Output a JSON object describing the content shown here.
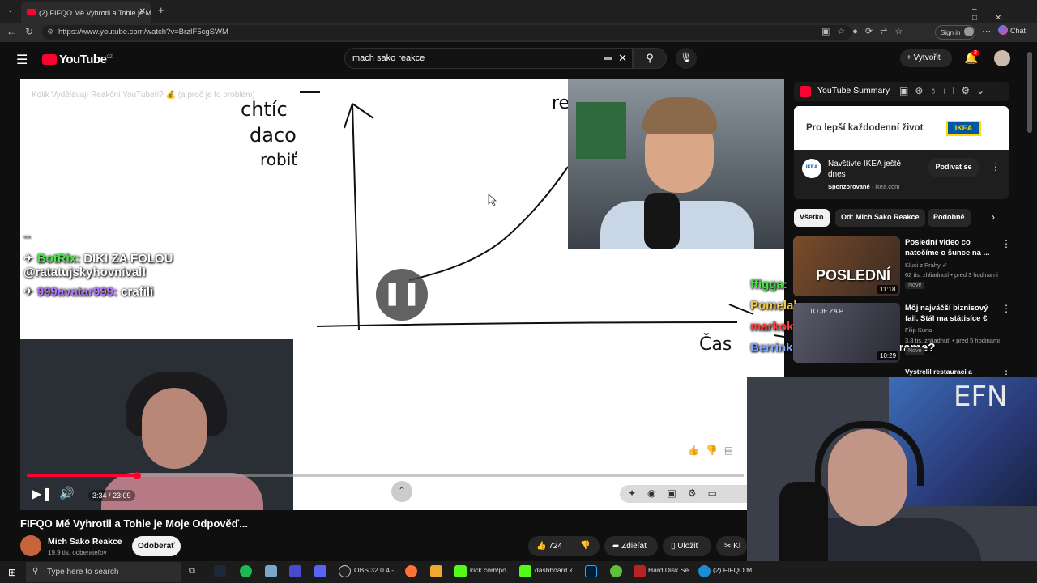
{
  "browser": {
    "tab_title": "(2) FIFQO Mě Vyhrotil a Tohle je M",
    "url": "https://www.youtube.com/watch?v=BrzIF5cgSWM",
    "sign_in": "Sign in",
    "chat_label": "Chat"
  },
  "youtube": {
    "logo": "YouTube",
    "region": "CZ",
    "search_value": "mach sako reakce",
    "create_label": "Vytvořit",
    "notif_count": "2"
  },
  "video": {
    "overlay_title": "Kolik Vydělávají Reakční YouTubeři? 💰 (a proč je to problém)",
    "whiteboard_text_1": "chtíc",
    "whiteboard_text_2": "daco",
    "whiteboard_text_3": "robiť",
    "whiteboard_text_4": "re",
    "whiteboard_axis": "Čas",
    "chat": [
      {
        "user": "BotRix:",
        "msg": " DIKI ZA FOLOU",
        "msg2": "@ratatujskyhovnival!",
        "color": "#4be34b"
      },
      {
        "user": "999avatar999:",
        "msg": " crafili",
        "color": "#b277ff"
      }
    ],
    "time": "3:34 / 23:09",
    "progress_fraction": 0.154
  },
  "right_chat": [
    {
      "user": "ffigga:",
      "msg": "",
      "cls": "g"
    },
    {
      "user": "Pomelak:",
      "msg": "",
      "cls": "y"
    },
    {
      "user": "markokokotko:",
      "msg": "",
      "cls": "r"
    },
    {
      "user": "Berrinka:",
      "msg": " to ho stale pozerame?",
      "cls": "b"
    }
  ],
  "below": {
    "headline": "FIFQO Mě Vyhrotil a Tohle je Moje Odpověď...",
    "channel": "Mich Sako Reakce",
    "subs": "19,9 tis. odberateľov",
    "subscribe": "Odoberať",
    "likes": "724",
    "share": "Zdieľať",
    "save": "Uložiť",
    "clip": "Kl"
  },
  "sidebar": {
    "summary_title": "YouTube Summary",
    "ad_text": "Pro lepší každodenní život",
    "ad_brand": "IKEA",
    "ad_title": "Navštivte IKEA ještě dnes",
    "ad_sponsor": "Sponzorované",
    "ad_domain": " · ikea.com",
    "ad_button": "Podívat se",
    "chips": [
      "Všetko",
      "Od: Mich Sako Reakce",
      "Podobné"
    ],
    "videos": [
      {
        "title": "Poslední video co natočíme o šunce na ...",
        "channel": "Kluci z Prahy ✔",
        "meta": "62 tis. zhliadnutí • pred 3 hodinami",
        "badge": "Nové",
        "duration": "11:18",
        "thumb_text": "POSLEDNÍ"
      },
      {
        "title": "Môj najväčší biznisový fail. Stál ma státisíce €",
        "channel": "Filip Kuna",
        "meta": "3,8 tis. zhliadnutí • pred 5 hodinami",
        "badge": "Nové",
        "duration": "10:29",
        "thumb_text": "TO JE ZA P"
      },
      {
        "title": "Vystrelil restauraci a",
        "channel": "",
        "meta": "",
        "badge": "",
        "duration": "",
        "thumb_text": ""
      }
    ]
  },
  "webcam_bg_text": "EFN",
  "taskbar": {
    "search": "Type here to search",
    "items": [
      "OBS 32.0.4 - ...",
      "kick.com/po...",
      "dashboard.k...",
      "Hard Disk Se...",
      "(2) FIFQO M"
    ]
  },
  "colors": {
    "accent": "#ff0033",
    "bg": "#0f0f0f",
    "ikea_blue": "#0058a3",
    "ikea_yellow": "#ffdb00"
  }
}
